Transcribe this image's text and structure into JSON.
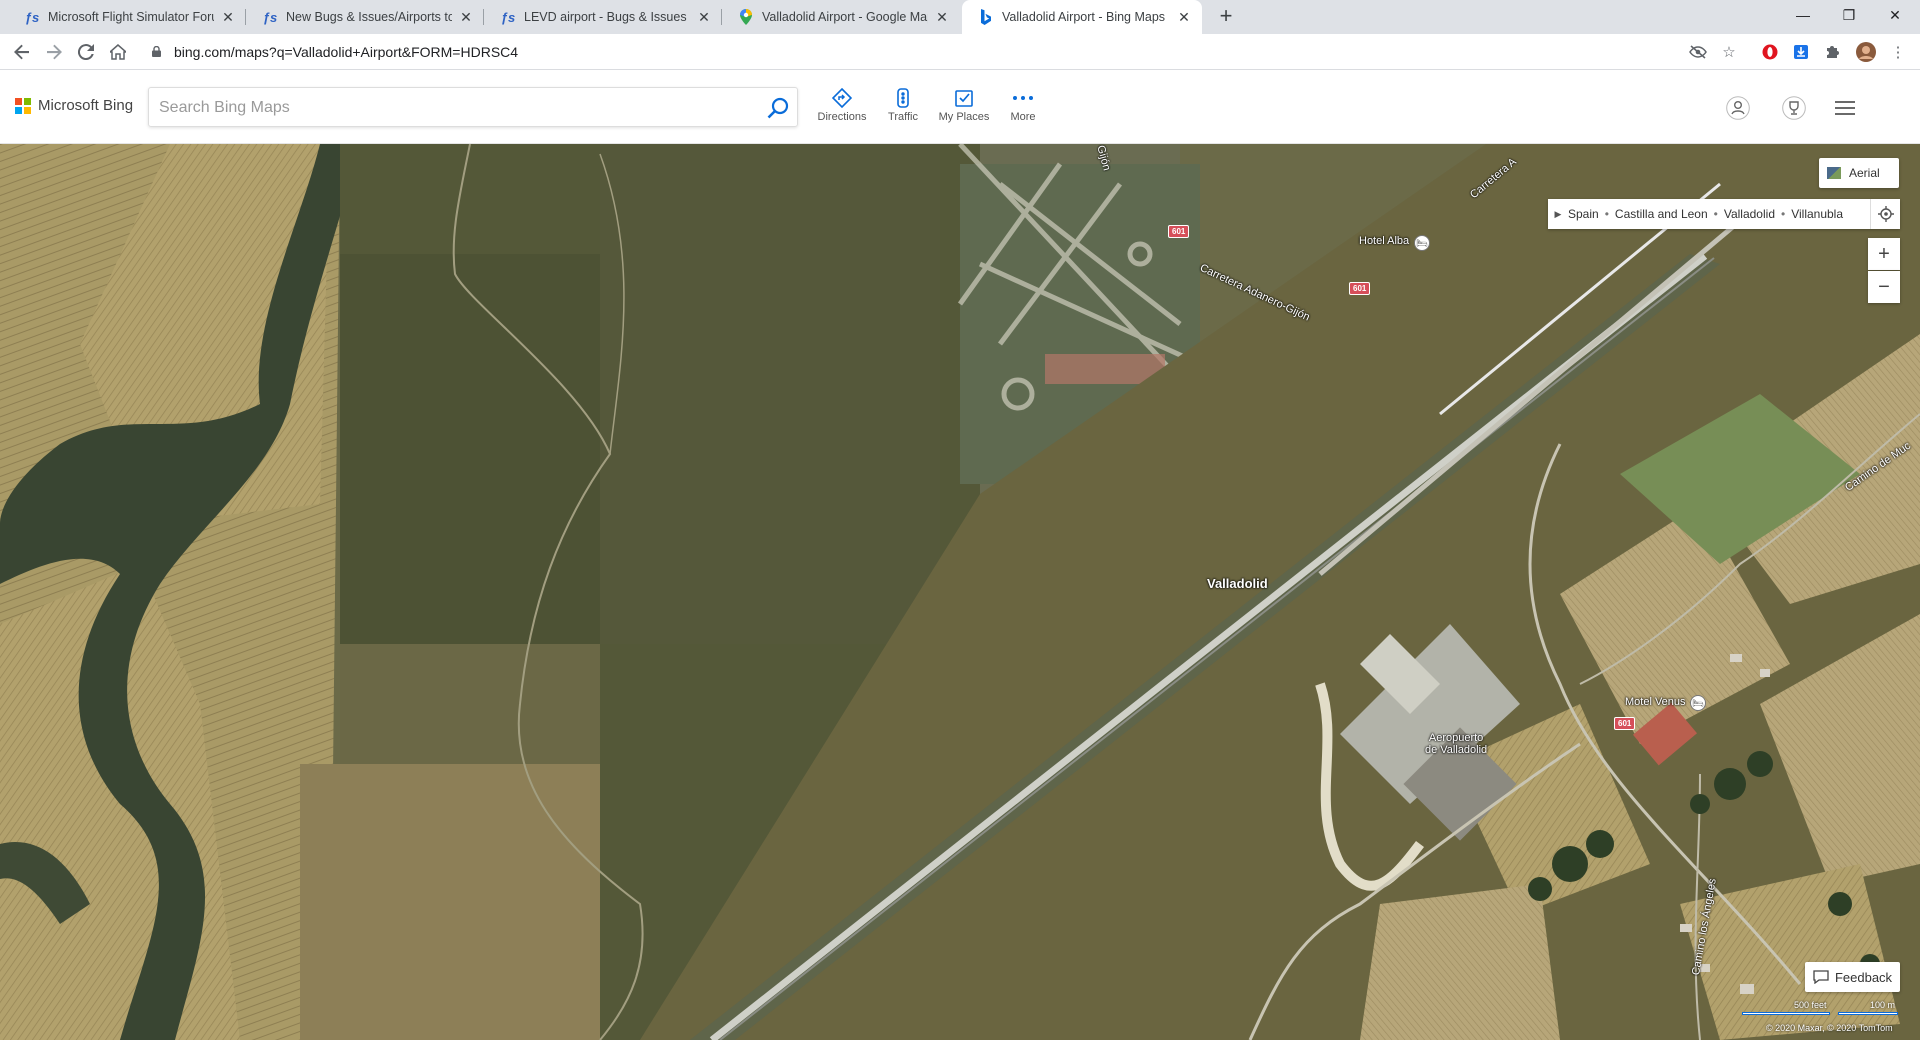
{
  "browser": {
    "tabs": [
      {
        "title": "Microsoft Flight Simulator Forum",
        "favicon": "flight-simulator-icon",
        "active": false
      },
      {
        "title": "New Bugs & Issues/Airports topi",
        "favicon": "flight-simulator-icon",
        "active": false
      },
      {
        "title": "LEVD airport - Bugs & Issues / A",
        "favicon": "flight-simulator-icon",
        "active": false
      },
      {
        "title": "Valladolid Airport - Google Maps",
        "favicon": "google-maps-pin-icon",
        "active": false
      },
      {
        "title": "Valladolid Airport - Bing Maps",
        "favicon": "bing-icon",
        "active": true
      }
    ],
    "new_tab": "+",
    "url": "bing.com/maps?q=Valladolid+Airport&FORM=HDRSC4",
    "window_controls": {
      "minimize": "—",
      "maximize": "❐",
      "close": "✕"
    }
  },
  "bing": {
    "brand": "Microsoft Bing",
    "search": {
      "placeholder": "Search Bing Maps",
      "value": ""
    },
    "nav": [
      {
        "label": "Directions",
        "icon": "directions-icon"
      },
      {
        "label": "Traffic",
        "icon": "traffic-light-icon"
      },
      {
        "label": "My Places",
        "icon": "my-places-icon"
      },
      {
        "label": "More",
        "icon": "more-dots-icon"
      }
    ],
    "colors": {
      "ms_red": "#f25022",
      "ms_green": "#7fba00",
      "ms_blue": "#00a4ef",
      "ms_yellow": "#ffb900",
      "accent": "#0a6cd9"
    }
  },
  "map": {
    "style_button": "Aerial",
    "breadcrumbs": [
      "Spain",
      "Castilla and Leon",
      "Valladolid",
      "Villanubla"
    ],
    "zoom_in": "+",
    "zoom_out": "−",
    "labels": {
      "city": "Valladolid",
      "airport_line1": "Aeropuerto",
      "airport_line2": "de Valladolid",
      "hotel": "Hotel Alba",
      "motel": "Motel Venus",
      "road_carretera_adanero": "Carretera Adanero-Gijón",
      "road_carretera_top": "Carretera A",
      "road_camino_muc": "Camino de Muc",
      "road_camino_angeles": "Camino los Ángeles",
      "road_gij": "Gijón"
    },
    "shields": [
      "601",
      "601",
      "601"
    ],
    "feedback": "Feedback",
    "scale": {
      "feet": "500 feet",
      "meters": "100 m"
    },
    "copyright": "© 2020 Maxar, © 2020 TomTom"
  }
}
